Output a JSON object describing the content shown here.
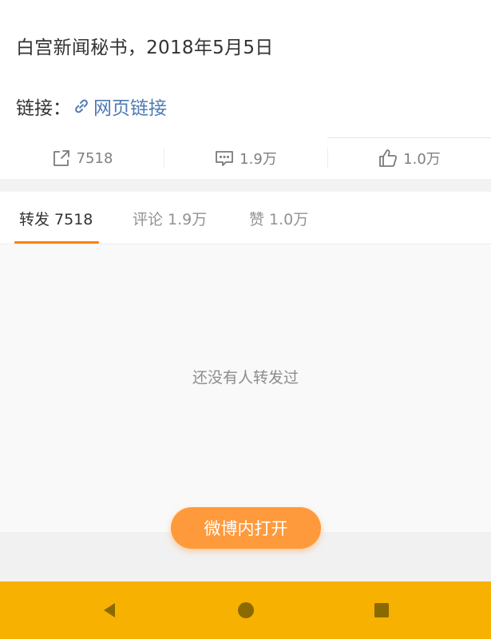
{
  "post": {
    "text": "白宫新闻秘书，2018年5月5日",
    "link_label": "链接：",
    "link_text": "网页链接"
  },
  "actions": {
    "repost_count": "7518",
    "comment_count": "1.9万",
    "like_count": "1.0万"
  },
  "tabs": [
    {
      "label": "转发 7518",
      "active": true
    },
    {
      "label": "评论 1.9万",
      "active": false
    },
    {
      "label": "赞 1.0万",
      "active": false
    }
  ],
  "empty_message": "还没有人转发过",
  "open_button": "微博内打开",
  "colors": {
    "accent": "#ff8200",
    "button": "#ff9a3c",
    "link": "#4e7ab5",
    "nav_bar": "#f7b100",
    "nav_icon": "#8a6a00"
  },
  "icons": [
    "link-icon",
    "repost-icon",
    "comment-icon",
    "like-icon",
    "back-icon",
    "home-icon",
    "recent-apps-icon"
  ]
}
